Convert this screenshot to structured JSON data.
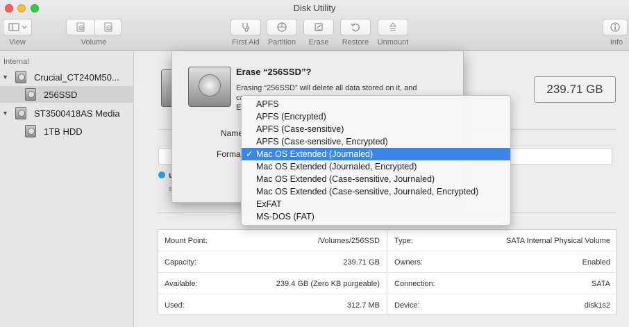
{
  "window": {
    "title": "Disk Utility"
  },
  "toolbar": {
    "view_label": "View",
    "volume_label": "Volume",
    "first_aid_label": "First Aid",
    "partition_label": "Partition",
    "erase_label": "Erase",
    "restore_label": "Restore",
    "unmount_label": "Unmount",
    "info_label": "Info"
  },
  "sidebar": {
    "section": "Internal",
    "items": [
      {
        "label": "Crucial_CT240M50...",
        "type": "disk"
      },
      {
        "label": "256SSD",
        "type": "volume",
        "selected": true
      },
      {
        "label": "ST3500418AS Media",
        "type": "disk"
      },
      {
        "label": "1TB HDD",
        "type": "volume"
      }
    ]
  },
  "main": {
    "size": "239.71 GB",
    "status_letter": "u",
    "status_sub": "s"
  },
  "sheet": {
    "title": "Erase “256SSD”?",
    "body_line1": "Erasing “256SSD” will delete all data stored on it, and",
    "body_line2": "ca",
    "body_line3": "Er",
    "name_label": "Name",
    "format_label": "Format"
  },
  "format_menu": {
    "selected_index": 4,
    "check": "✓",
    "options": [
      "APFS",
      "APFS (Encrypted)",
      "APFS (Case-sensitive)",
      "APFS (Case-sensitive, Encrypted)",
      "Mac OS Extended (Journaled)",
      "Mac OS Extended (Journaled, Encrypted)",
      "Mac OS Extended (Case-sensitive, Journaled)",
      "Mac OS Extended (Case-sensitive, Journaled, Encrypted)",
      "ExFAT",
      "MS-DOS (FAT)"
    ]
  },
  "info": {
    "left": [
      {
        "key": "Mount Point:",
        "value": "/Volumes/256SSD"
      },
      {
        "key": "Capacity:",
        "value": "239.71 GB"
      },
      {
        "key": "Available:",
        "value": "239.4 GB (Zero KB purgeable)"
      },
      {
        "key": "Used:",
        "value": "312.7 MB"
      }
    ],
    "right": [
      {
        "key": "Type:",
        "value": "SATA Internal Physical Volume"
      },
      {
        "key": "Owners:",
        "value": "Enabled"
      },
      {
        "key": "Connection:",
        "value": "SATA"
      },
      {
        "key": "Device:",
        "value": "disk1s2"
      }
    ]
  }
}
